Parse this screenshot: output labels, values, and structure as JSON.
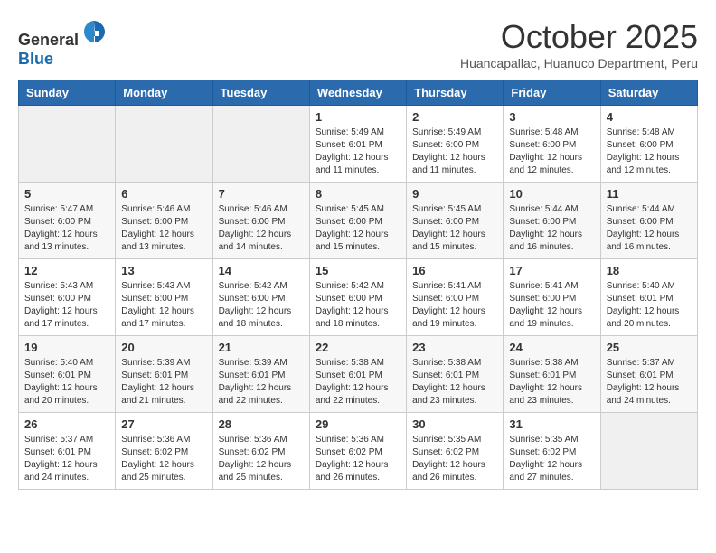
{
  "header": {
    "logo_general": "General",
    "logo_blue": "Blue",
    "month": "October 2025",
    "location": "Huancapallac, Huanuco Department, Peru"
  },
  "weekdays": [
    "Sunday",
    "Monday",
    "Tuesday",
    "Wednesday",
    "Thursday",
    "Friday",
    "Saturday"
  ],
  "weeks": [
    [
      {
        "day": "",
        "info": ""
      },
      {
        "day": "",
        "info": ""
      },
      {
        "day": "",
        "info": ""
      },
      {
        "day": "1",
        "info": "Sunrise: 5:49 AM\nSunset: 6:01 PM\nDaylight: 12 hours\nand 11 minutes."
      },
      {
        "day": "2",
        "info": "Sunrise: 5:49 AM\nSunset: 6:00 PM\nDaylight: 12 hours\nand 11 minutes."
      },
      {
        "day": "3",
        "info": "Sunrise: 5:48 AM\nSunset: 6:00 PM\nDaylight: 12 hours\nand 12 minutes."
      },
      {
        "day": "4",
        "info": "Sunrise: 5:48 AM\nSunset: 6:00 PM\nDaylight: 12 hours\nand 12 minutes."
      }
    ],
    [
      {
        "day": "5",
        "info": "Sunrise: 5:47 AM\nSunset: 6:00 PM\nDaylight: 12 hours\nand 13 minutes."
      },
      {
        "day": "6",
        "info": "Sunrise: 5:46 AM\nSunset: 6:00 PM\nDaylight: 12 hours\nand 13 minutes."
      },
      {
        "day": "7",
        "info": "Sunrise: 5:46 AM\nSunset: 6:00 PM\nDaylight: 12 hours\nand 14 minutes."
      },
      {
        "day": "8",
        "info": "Sunrise: 5:45 AM\nSunset: 6:00 PM\nDaylight: 12 hours\nand 15 minutes."
      },
      {
        "day": "9",
        "info": "Sunrise: 5:45 AM\nSunset: 6:00 PM\nDaylight: 12 hours\nand 15 minutes."
      },
      {
        "day": "10",
        "info": "Sunrise: 5:44 AM\nSunset: 6:00 PM\nDaylight: 12 hours\nand 16 minutes."
      },
      {
        "day": "11",
        "info": "Sunrise: 5:44 AM\nSunset: 6:00 PM\nDaylight: 12 hours\nand 16 minutes."
      }
    ],
    [
      {
        "day": "12",
        "info": "Sunrise: 5:43 AM\nSunset: 6:00 PM\nDaylight: 12 hours\nand 17 minutes."
      },
      {
        "day": "13",
        "info": "Sunrise: 5:43 AM\nSunset: 6:00 PM\nDaylight: 12 hours\nand 17 minutes."
      },
      {
        "day": "14",
        "info": "Sunrise: 5:42 AM\nSunset: 6:00 PM\nDaylight: 12 hours\nand 18 minutes."
      },
      {
        "day": "15",
        "info": "Sunrise: 5:42 AM\nSunset: 6:00 PM\nDaylight: 12 hours\nand 18 minutes."
      },
      {
        "day": "16",
        "info": "Sunrise: 5:41 AM\nSunset: 6:00 PM\nDaylight: 12 hours\nand 19 minutes."
      },
      {
        "day": "17",
        "info": "Sunrise: 5:41 AM\nSunset: 6:00 PM\nDaylight: 12 hours\nand 19 minutes."
      },
      {
        "day": "18",
        "info": "Sunrise: 5:40 AM\nSunset: 6:01 PM\nDaylight: 12 hours\nand 20 minutes."
      }
    ],
    [
      {
        "day": "19",
        "info": "Sunrise: 5:40 AM\nSunset: 6:01 PM\nDaylight: 12 hours\nand 20 minutes."
      },
      {
        "day": "20",
        "info": "Sunrise: 5:39 AM\nSunset: 6:01 PM\nDaylight: 12 hours\nand 21 minutes."
      },
      {
        "day": "21",
        "info": "Sunrise: 5:39 AM\nSunset: 6:01 PM\nDaylight: 12 hours\nand 22 minutes."
      },
      {
        "day": "22",
        "info": "Sunrise: 5:38 AM\nSunset: 6:01 PM\nDaylight: 12 hours\nand 22 minutes."
      },
      {
        "day": "23",
        "info": "Sunrise: 5:38 AM\nSunset: 6:01 PM\nDaylight: 12 hours\nand 23 minutes."
      },
      {
        "day": "24",
        "info": "Sunrise: 5:38 AM\nSunset: 6:01 PM\nDaylight: 12 hours\nand 23 minutes."
      },
      {
        "day": "25",
        "info": "Sunrise: 5:37 AM\nSunset: 6:01 PM\nDaylight: 12 hours\nand 24 minutes."
      }
    ],
    [
      {
        "day": "26",
        "info": "Sunrise: 5:37 AM\nSunset: 6:01 PM\nDaylight: 12 hours\nand 24 minutes."
      },
      {
        "day": "27",
        "info": "Sunrise: 5:36 AM\nSunset: 6:02 PM\nDaylight: 12 hours\nand 25 minutes."
      },
      {
        "day": "28",
        "info": "Sunrise: 5:36 AM\nSunset: 6:02 PM\nDaylight: 12 hours\nand 25 minutes."
      },
      {
        "day": "29",
        "info": "Sunrise: 5:36 AM\nSunset: 6:02 PM\nDaylight: 12 hours\nand 26 minutes."
      },
      {
        "day": "30",
        "info": "Sunrise: 5:35 AM\nSunset: 6:02 PM\nDaylight: 12 hours\nand 26 minutes."
      },
      {
        "day": "31",
        "info": "Sunrise: 5:35 AM\nSunset: 6:02 PM\nDaylight: 12 hours\nand 27 minutes."
      },
      {
        "day": "",
        "info": ""
      }
    ]
  ]
}
